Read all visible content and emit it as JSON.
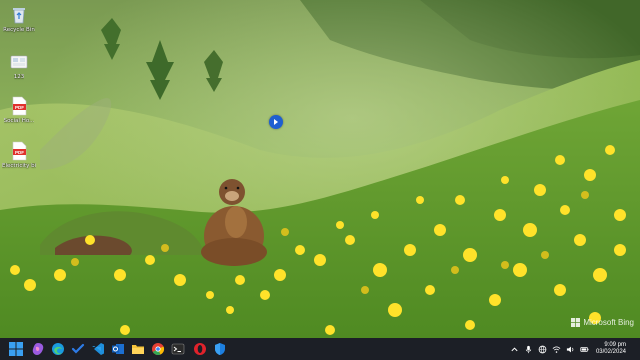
{
  "desktop_icons": [
    {
      "label": "Recycle Bin",
      "icon": "recycle-bin-icon"
    },
    {
      "label": "123",
      "icon": "folder-icon"
    },
    {
      "label": "Social Ho...",
      "icon": "pdf-file-icon"
    },
    {
      "label": "Electricity bi...",
      "icon": "pdf-file-icon"
    }
  ],
  "watermark": {
    "text": "Microsoft Bing"
  },
  "taskbar": {
    "apps": [
      "start-icon",
      "copilot-icon",
      "edge-icon",
      "todo-icon",
      "vscode-icon",
      "outlook-icon",
      "file-explorer-icon",
      "chrome-icon",
      "terminal-icon",
      "opera-icon",
      "defender-icon"
    ]
  },
  "tray": {
    "time": "9:09 pm",
    "date": "03/02/2024",
    "icons": [
      "chevron-up-icon",
      "microphone-icon",
      "network-icon",
      "wifi-icon",
      "volume-icon",
      "battery-icon"
    ]
  },
  "colors": {
    "taskbar": "#1c1f26",
    "accent": "#1f5fd1"
  }
}
